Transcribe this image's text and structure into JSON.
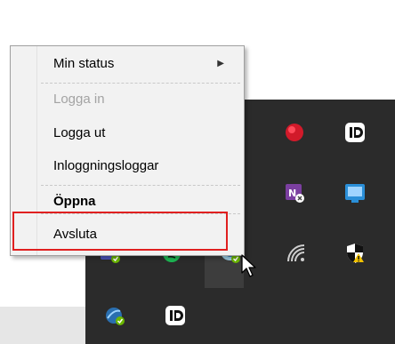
{
  "menu": {
    "items": [
      {
        "label": "Min status",
        "state": "submenu"
      },
      {
        "label": "Logga in",
        "state": "disabled"
      },
      {
        "label": "Logga ut",
        "state": "normal"
      },
      {
        "label": "Inloggningsloggar",
        "state": "normal"
      },
      {
        "label": "Öppna",
        "state": "default-bold"
      },
      {
        "label": "Avsluta",
        "state": "highlighted"
      }
    ]
  },
  "tray": {
    "icons": [
      "red-circle-app-icon",
      "id-app-icon",
      "onenote-sync-icon",
      "network-drive-icon",
      "teams-icon",
      "spotify-icon",
      "vpn-shield-icon",
      "wifi-icon",
      "security-warning-icon",
      "onedrive-icon",
      "id-app-icon-2"
    ]
  },
  "colors": {
    "menu_bg": "#f2f2f2",
    "tray_bg": "#2b2b2b",
    "highlight_border": "#e02020",
    "disabled_text": "#a3a3a3"
  }
}
